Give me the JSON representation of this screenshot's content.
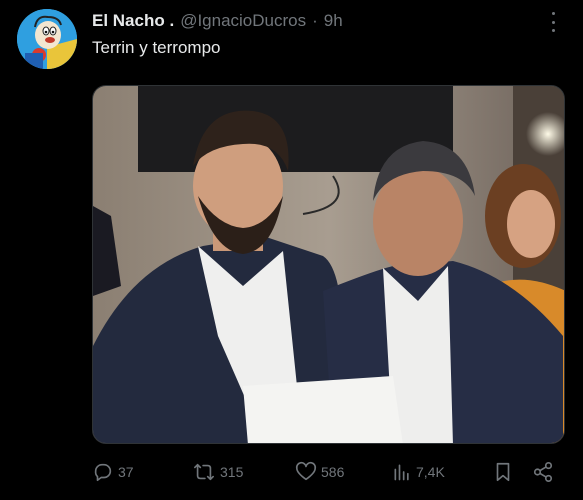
{
  "tweet": {
    "display_name": "El Nacho .",
    "handle": "@IgnacioDucros",
    "separator": "·",
    "time": "9h",
    "text": "Terrin y terrompo",
    "avatar_icon": "cartoon-avatar",
    "media": {
      "kind": "photo",
      "icon": "photo-image"
    }
  },
  "actions": {
    "replies": "37",
    "reposts": "315",
    "likes": "586",
    "views": "7,4K",
    "icons": [
      "reply-icon",
      "repost-icon",
      "like-icon",
      "views-icon",
      "bookmark-icon",
      "share-icon"
    ]
  },
  "colors": {
    "background": "#000000",
    "text": "#e7e9ea",
    "muted": "#71767b"
  }
}
